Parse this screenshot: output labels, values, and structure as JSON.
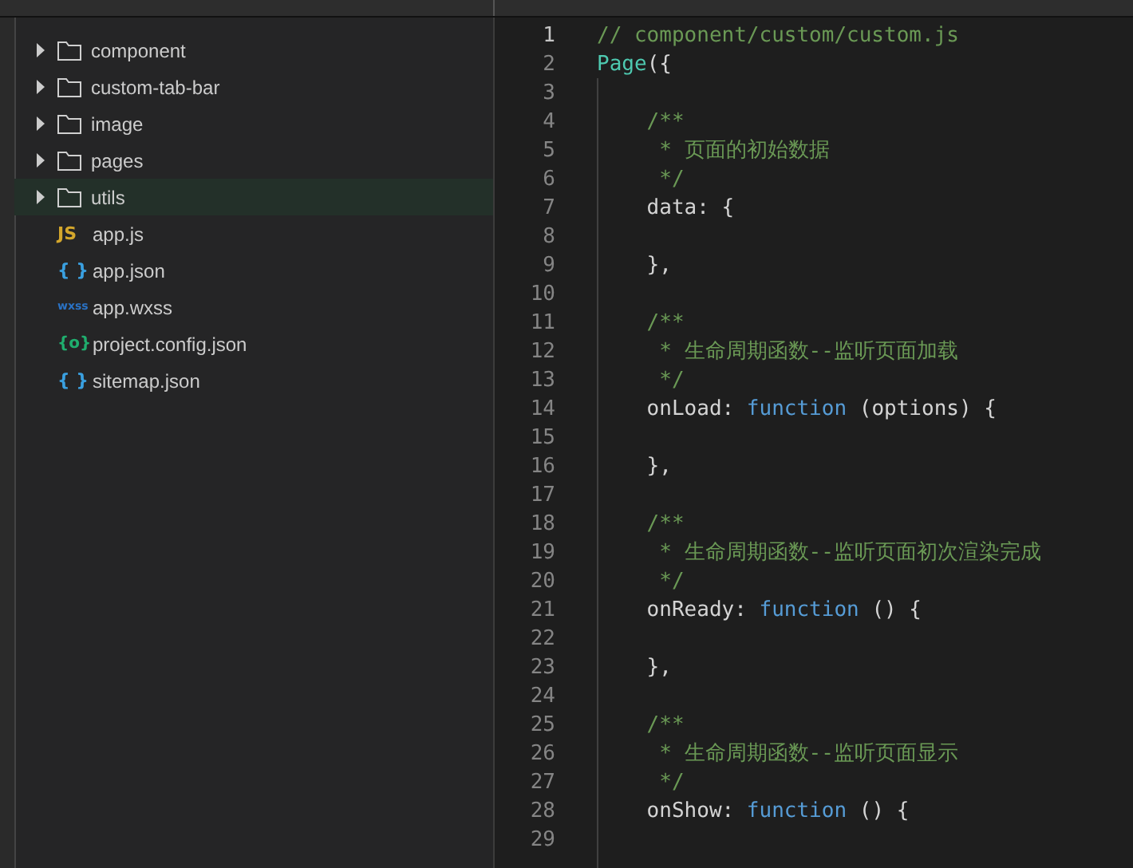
{
  "sidebar": {
    "items": [
      {
        "kind": "folder",
        "name": "component",
        "expanded": false,
        "selected": false
      },
      {
        "kind": "folder",
        "name": "custom-tab-bar",
        "expanded": false,
        "selected": false
      },
      {
        "kind": "folder",
        "name": "image",
        "expanded": false,
        "selected": false
      },
      {
        "kind": "folder",
        "name": "pages",
        "expanded": false,
        "selected": false
      },
      {
        "kind": "folder",
        "name": "utils",
        "expanded": false,
        "selected": true
      },
      {
        "kind": "js",
        "icon": "JS",
        "name": "app.js",
        "selected": false
      },
      {
        "kind": "json",
        "icon": "{ }",
        "name": "app.json",
        "selected": false
      },
      {
        "kind": "wxss",
        "icon": "wxss",
        "name": "app.wxss",
        "selected": false
      },
      {
        "kind": "config",
        "icon": "{o}",
        "name": "project.config.json",
        "selected": false
      },
      {
        "kind": "json",
        "icon": "{ }",
        "name": "sitemap.json",
        "selected": false
      }
    ]
  },
  "editor": {
    "lines": [
      {
        "number": "1",
        "tokens": [
          {
            "kind": "comment",
            "text": "// component/custom/custom.js"
          }
        ]
      },
      {
        "number": "2",
        "tokens": [
          {
            "kind": "class",
            "text": "Page"
          },
          {
            "kind": "plain",
            "text": "({"
          }
        ]
      },
      {
        "number": "3"
      },
      {
        "number": "4",
        "tokens": [
          {
            "kind": "comment",
            "text": "    /**"
          }
        ]
      },
      {
        "number": "5",
        "tokens": [
          {
            "kind": "comment",
            "text": "     * 页面的初始数据"
          }
        ]
      },
      {
        "number": "6",
        "tokens": [
          {
            "kind": "comment",
            "text": "     */"
          }
        ]
      },
      {
        "number": "7",
        "tokens": [
          {
            "kind": "plain",
            "text": "    data: {"
          }
        ]
      },
      {
        "number": "8"
      },
      {
        "number": "9",
        "tokens": [
          {
            "kind": "plain",
            "text": "    },"
          }
        ]
      },
      {
        "number": "10"
      },
      {
        "number": "11",
        "tokens": [
          {
            "kind": "comment",
            "text": "    /**"
          }
        ]
      },
      {
        "number": "12",
        "tokens": [
          {
            "kind": "comment",
            "text": "     * 生命周期函数--监听页面加载"
          }
        ]
      },
      {
        "number": "13",
        "tokens": [
          {
            "kind": "comment",
            "text": "     */"
          }
        ]
      },
      {
        "number": "14",
        "tokens": [
          {
            "kind": "plain",
            "text": "    onLoad: "
          },
          {
            "kind": "keyword",
            "text": "function"
          },
          {
            "kind": "plain",
            "text": " (options) {"
          }
        ]
      },
      {
        "number": "15"
      },
      {
        "number": "16",
        "tokens": [
          {
            "kind": "plain",
            "text": "    },"
          }
        ]
      },
      {
        "number": "17"
      },
      {
        "number": "18",
        "tokens": [
          {
            "kind": "comment",
            "text": "    /**"
          }
        ]
      },
      {
        "number": "19",
        "tokens": [
          {
            "kind": "comment",
            "text": "     * 生命周期函数--监听页面初次渲染完成"
          }
        ]
      },
      {
        "number": "20",
        "tokens": [
          {
            "kind": "comment",
            "text": "     */"
          }
        ]
      },
      {
        "number": "21",
        "tokens": [
          {
            "kind": "plain",
            "text": "    onReady: "
          },
          {
            "kind": "keyword",
            "text": "function"
          },
          {
            "kind": "plain",
            "text": " () {"
          }
        ]
      },
      {
        "number": "22"
      },
      {
        "number": "23",
        "tokens": [
          {
            "kind": "plain",
            "text": "    },"
          }
        ]
      },
      {
        "number": "24"
      },
      {
        "number": "25",
        "tokens": [
          {
            "kind": "comment",
            "text": "    /**"
          }
        ]
      },
      {
        "number": "26",
        "tokens": [
          {
            "kind": "comment",
            "text": "     * 生命周期函数--监听页面显示"
          }
        ]
      },
      {
        "number": "27",
        "tokens": [
          {
            "kind": "comment",
            "text": "     */"
          }
        ]
      },
      {
        "number": "28",
        "tokens": [
          {
            "kind": "plain",
            "text": "    onShow: "
          },
          {
            "kind": "keyword",
            "text": "function"
          },
          {
            "kind": "plain",
            "text": " () {"
          }
        ]
      },
      {
        "number": "29"
      }
    ]
  }
}
